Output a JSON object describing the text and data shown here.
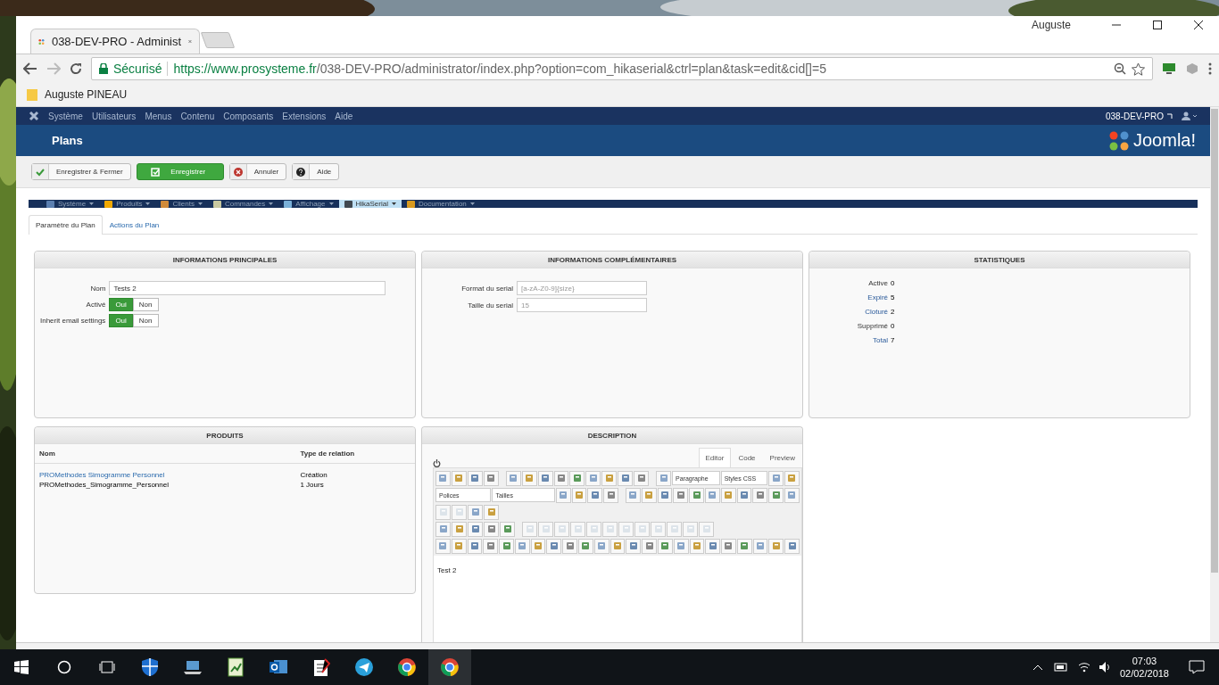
{
  "browser": {
    "tab_title": "038-DEV-PRO - Administ",
    "user": "Auguste",
    "security": "Sécurisé",
    "url_host": "https://www.prosysteme.fr",
    "url_path": "/038-DEV-PRO/administrator/index.php?option=com_hikaserial&ctrl=plan&task=edit&cid[]=5",
    "bookmarks": [
      "Auguste PINEAU"
    ]
  },
  "admin_menu": {
    "items": [
      "Système",
      "Utilisateurs",
      "Menus",
      "Contenu",
      "Composants",
      "Extensions",
      "Aide"
    ],
    "site": "038-DEV-PRO"
  },
  "header": {
    "title": "Plans",
    "logo": "Joomla!"
  },
  "toolbar": [
    {
      "kind": "save-close",
      "label": "Enregistrer & Fermer"
    },
    {
      "kind": "save",
      "label": "Enregistrer"
    },
    {
      "kind": "cancel",
      "label": "Annuler"
    },
    {
      "kind": "help",
      "label": "Aide"
    }
  ],
  "component_menu": [
    {
      "label": "Système",
      "selected": false,
      "color": "#5b7fb0"
    },
    {
      "label": "Produits",
      "selected": false,
      "color": "#f0a800"
    },
    {
      "label": "Clients",
      "selected": false,
      "color": "#d08a3a"
    },
    {
      "label": "Commandes",
      "selected": false,
      "color": "#c8c8a0"
    },
    {
      "label": "Affichage",
      "selected": false,
      "color": "#7ab0d8"
    },
    {
      "label": "HikaSerial",
      "selected": true,
      "color": "#404850"
    },
    {
      "label": "Documentation",
      "selected": false,
      "color": "#d89a20"
    }
  ],
  "tabs": [
    {
      "label": "Paramètre du Plan",
      "selected": true
    },
    {
      "label": "Actions du Plan",
      "selected": false
    }
  ],
  "main_info": {
    "title": "INFORMATIONS PRINCIPALES",
    "fields": [
      {
        "kind": "text",
        "label": "Nom",
        "value": "Tests 2"
      },
      {
        "kind": "toggle",
        "label": "Activé",
        "yes": "Oui",
        "no": "Non",
        "on": true
      },
      {
        "kind": "toggle",
        "label": "Inherit email settings",
        "yes": "Oui",
        "no": "Non",
        "on": true
      }
    ]
  },
  "extra_info": {
    "title": "INFORMATIONS COMPLÉMENTAIRES",
    "fields": [
      {
        "label": "Format du serial",
        "placeholder": "[a-zA-Z0-9]{size}"
      },
      {
        "label": "Taille du serial",
        "placeholder": "15"
      }
    ]
  },
  "stats": {
    "title": "STATISTIQUES",
    "rows": [
      {
        "kind": "plain",
        "label": "Active",
        "value": "0"
      },
      {
        "kind": "link",
        "label": "Expiré",
        "value": "5"
      },
      {
        "kind": "link",
        "label": "Cloturé",
        "value": "2"
      },
      {
        "kind": "plain",
        "label": "Supprimé",
        "value": "0"
      },
      {
        "kind": "link",
        "label": "Total",
        "value": "7"
      }
    ]
  },
  "products": {
    "title": "PRODUITS",
    "columns": [
      "Nom",
      "Type de relation"
    ],
    "rows": [
      {
        "name": "PROMethodes Simogramme Personnel",
        "code": "PROMethodes_Simogramme_Personnel",
        "relation": "Création",
        "duration": "1 Jours"
      }
    ]
  },
  "description": {
    "title": "DESCRIPTION",
    "tabs": [
      {
        "label": "Editor",
        "selected": true
      },
      {
        "label": "Code",
        "selected": false
      },
      {
        "label": "Preview",
        "selected": false
      }
    ],
    "paragraph": "Paragraphe",
    "styles": "Styles CSS",
    "fonts": "Polices",
    "sizes": "Tailles",
    "content": "Test 2"
  },
  "taskbar": {
    "time": "07:03",
    "date": "02/02/2018"
  }
}
